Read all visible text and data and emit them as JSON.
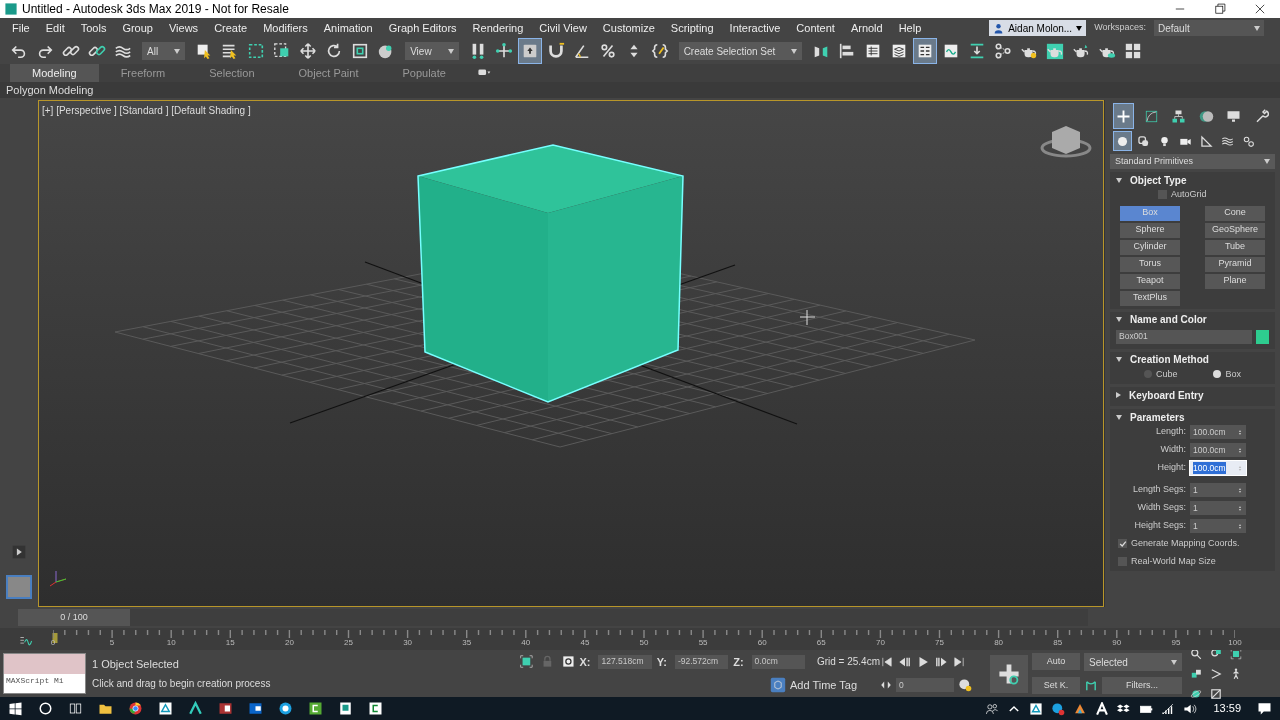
{
  "window": {
    "title": "Untitled - Autodesk 3ds Max 2019 - Not for Resale"
  },
  "menus": [
    "File",
    "Edit",
    "Tools",
    "Group",
    "Views",
    "Create",
    "Modifiers",
    "Animation",
    "Graph Editors",
    "Rendering",
    "Civil View",
    "Customize",
    "Scripting",
    "Interactive",
    "Content",
    "Arnold",
    "Help"
  ],
  "account": "Aidan Molon...",
  "workspaces": {
    "label": "Workspaces:",
    "value": "Default"
  },
  "toolbar": [
    {
      "kind": "button",
      "active": false
    },
    {
      "kind": "button",
      "active": false
    },
    {
      "kind": "button",
      "active": false
    },
    {
      "kind": "button",
      "active": false
    },
    {
      "kind": "button",
      "active": false
    },
    {
      "kind": "dropdown",
      "value": "All"
    },
    {
      "kind": "button",
      "active": false
    },
    {
      "kind": "button",
      "active": false
    },
    {
      "kind": "button",
      "active": false
    },
    {
      "kind": "button",
      "active": false
    },
    {
      "kind": "button",
      "active": false
    },
    {
      "kind": "button",
      "active": false
    },
    {
      "kind": "button",
      "active": false
    },
    {
      "kind": "button",
      "active": false
    },
    {
      "kind": "dropdown",
      "value": "View"
    },
    {
      "kind": "button",
      "active": false
    },
    {
      "kind": "button",
      "active": false
    },
    {
      "kind": "button",
      "active": true
    },
    {
      "kind": "button",
      "active": false
    },
    {
      "kind": "button",
      "active": false
    },
    {
      "kind": "button",
      "active": false
    },
    {
      "kind": "button",
      "active": false
    },
    {
      "kind": "button",
      "active": false
    },
    {
      "kind": "dropdown",
      "value": "Create Selection Set"
    },
    {
      "kind": "button",
      "active": false
    },
    {
      "kind": "button",
      "active": false
    },
    {
      "kind": "button",
      "active": false
    },
    {
      "kind": "button",
      "active": false
    },
    {
      "kind": "button",
      "active": true
    },
    {
      "kind": "button",
      "active": false
    },
    {
      "kind": "button",
      "active": false
    },
    {
      "kind": "button",
      "active": false
    },
    {
      "kind": "button",
      "active": false
    },
    {
      "kind": "button",
      "active": false
    },
    {
      "kind": "button",
      "active": false
    },
    {
      "kind": "button",
      "active": false
    },
    {
      "kind": "button",
      "active": false
    }
  ],
  "ribbon_tabs": [
    {
      "label": "Modeling",
      "selected": true
    },
    {
      "label": "Freeform",
      "selected": false
    },
    {
      "label": "Selection",
      "selected": false
    },
    {
      "label": "Object Paint",
      "selected": false
    },
    {
      "label": "Populate",
      "selected": false
    }
  ],
  "ribbon_panel": "Polygon Modeling",
  "viewport": {
    "label": "[+] [Perspective ] [Standard ] [Default Shading ]"
  },
  "command_panel": {
    "tabs": [
      {
        "selected": true
      },
      {
        "selected": false
      },
      {
        "selected": false
      },
      {
        "selected": false
      },
      {
        "selected": false
      },
      {
        "selected": false
      }
    ],
    "categories": [
      {
        "selected": true
      },
      {
        "selected": false
      },
      {
        "selected": false
      },
      {
        "selected": false
      },
      {
        "selected": false
      },
      {
        "selected": false
      },
      {
        "selected": false
      }
    ],
    "category_dropdown": "Standard Primitives",
    "rollouts": [
      {
        "kind": "buttons",
        "title": "Object Type",
        "expanded": true,
        "autogrid": {
          "label": "AutoGrid",
          "checked": false
        },
        "buttons": [
          {
            "label": "Box",
            "selected": true
          },
          {
            "label": "Cone",
            "selected": false
          },
          {
            "label": "Sphere",
            "selected": false
          },
          {
            "label": "GeoSphere",
            "selected": false
          },
          {
            "label": "Cylinder",
            "selected": false
          },
          {
            "label": "Tube",
            "selected": false
          },
          {
            "label": "Torus",
            "selected": false
          },
          {
            "label": "Pyramid",
            "selected": false
          },
          {
            "label": "Teapot",
            "selected": false
          },
          {
            "label": "Plane",
            "selected": false
          },
          {
            "label": "TextPlus",
            "selected": false
          }
        ]
      },
      {
        "kind": "name",
        "title": "Name and Color",
        "expanded": true,
        "name": "Box001",
        "color": "#2ecc8f"
      },
      {
        "kind": "radios",
        "title": "Creation Method",
        "expanded": true,
        "options": [
          {
            "label": "Cube",
            "selected": false
          },
          {
            "label": "Box",
            "selected": true
          }
        ]
      },
      {
        "title": "Keyboard Entry",
        "expanded": false
      },
      {
        "kind": "params",
        "title": "Parameters",
        "expanded": true,
        "fields": [
          {
            "label": "Length:",
            "value": "100.0cm",
            "selected": false
          },
          {
            "label": "Width:",
            "value": "100.0cm",
            "selected": false
          },
          {
            "label": "Height:",
            "value": "100.0cm",
            "selected": true
          }
        ],
        "segments": [
          {
            "label": "Length Segs:",
            "value": "1"
          },
          {
            "label": "Width Segs:",
            "value": "1"
          },
          {
            "label": "Height Segs:",
            "value": "1"
          }
        ],
        "checkboxes": [
          {
            "label": "Generate Mapping Coords.",
            "checked": true
          },
          {
            "label": "Real-World Map Size",
            "checked": false
          }
        ]
      }
    ]
  },
  "timeline": {
    "frame": "0 / 100",
    "level": 0,
    "ticks": [
      "0",
      "5",
      "10",
      "15",
      "20",
      "25",
      "30",
      "35",
      "40",
      "45",
      "50",
      "55",
      "60",
      "65",
      "70",
      "75",
      "80",
      "85",
      "90",
      "95",
      "100"
    ]
  },
  "status": {
    "listener": "MAXScript Mi",
    "selection": "1 Object Selected",
    "prompt": "Click and drag to begin creation process",
    "coords": [
      {
        "label": "X:",
        "value": "127.518cm"
      },
      {
        "label": "Y:",
        "value": "-92.572cm"
      },
      {
        "label": "Z:",
        "value": "0.0cm"
      }
    ],
    "grid": "Grid = 25.4cm",
    "time_tag": "Add Time Tag",
    "frame": "0",
    "auto": "Auto",
    "set_key": "Set K.",
    "key_filter": "Selected",
    "filters": "Filters..."
  },
  "taskbar": {
    "time": "13:59"
  }
}
